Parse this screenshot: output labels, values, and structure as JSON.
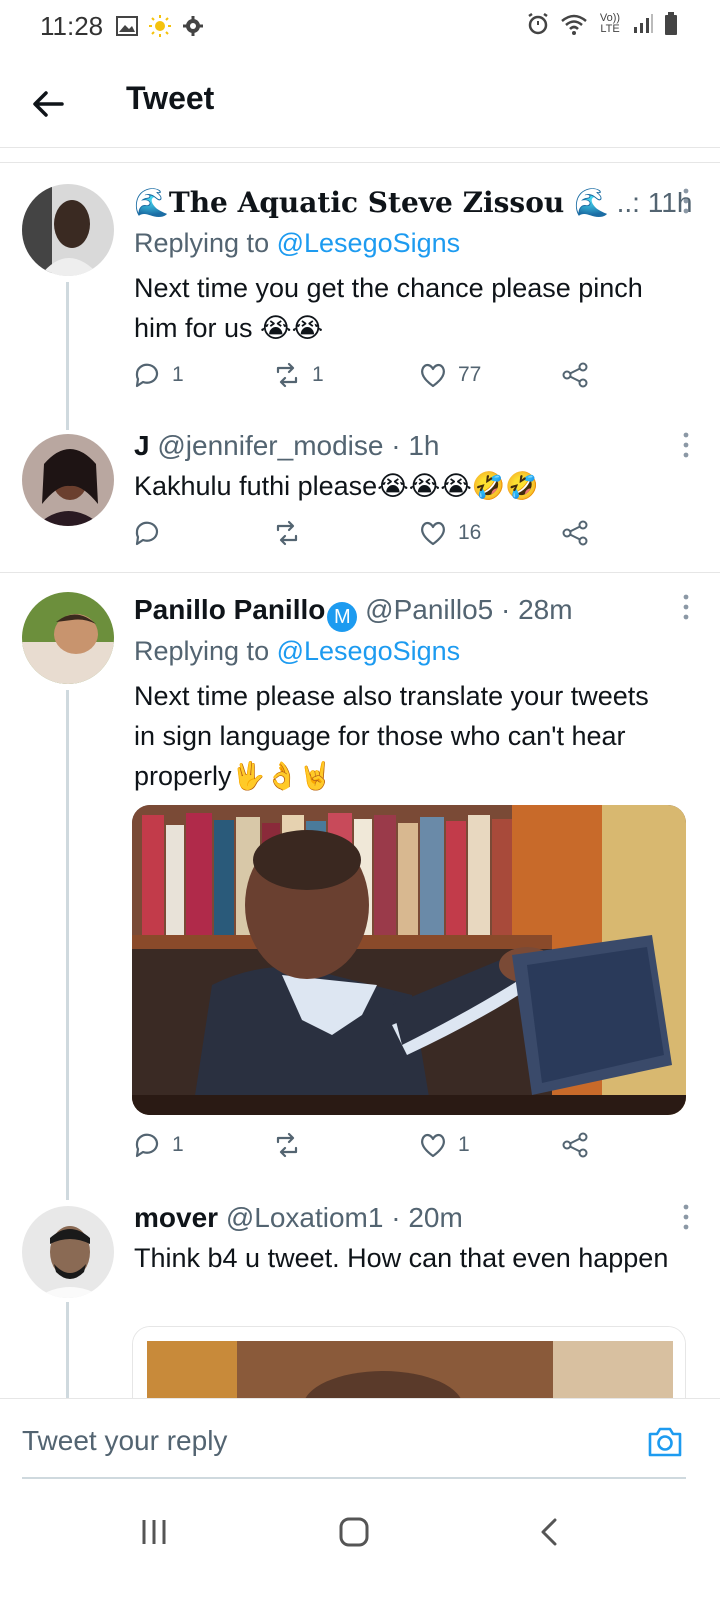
{
  "status_bar": {
    "time": "11:28",
    "network_label": "Vo)) LTE"
  },
  "header": {
    "title": "Tweet"
  },
  "tweets": [
    {
      "display_name": "🌊The Aquatic Steve Zissou 🌊",
      "handle": "..:",
      "time": "11h",
      "replying_prefix": "Replying to",
      "replying_to": "@LesegoSigns",
      "text": "Next time you get the chance please pinch him for us 😭😭",
      "replies": "1",
      "retweets": "1",
      "likes": "77"
    },
    {
      "display_name": "J",
      "handle": "@jennifer_modise",
      "time": "1h",
      "text": "Kakhulu futhi please😭😭😭🤣🤣",
      "replies": "",
      "retweets": "",
      "likes": "16"
    },
    {
      "display_name": "Panillo Panillo",
      "verified_badge": "M",
      "handle": "@Panillo5",
      "time": "28m",
      "replying_prefix": "Replying to",
      "replying_to": "@LesegoSigns",
      "text": "Next time please also translate your tweets in sign language for those who can't hear properly🖖👌🤘",
      "replies": "1",
      "retweets": "",
      "likes": "1"
    },
    {
      "display_name": "mover",
      "handle": "@Loxatiom1",
      "time": "20m",
      "text": "Think b4  u tweet. How can that even happen"
    }
  ],
  "reply_box": {
    "placeholder": "Tweet your reply"
  },
  "colors": {
    "accent": "#1d9bf0",
    "muted": "#536471",
    "divider": "#e6e6e6"
  },
  "icons": [
    "back-arrow-icon",
    "reply-icon",
    "retweet-icon",
    "like-icon",
    "share-icon",
    "camera-icon",
    "more-icon"
  ]
}
